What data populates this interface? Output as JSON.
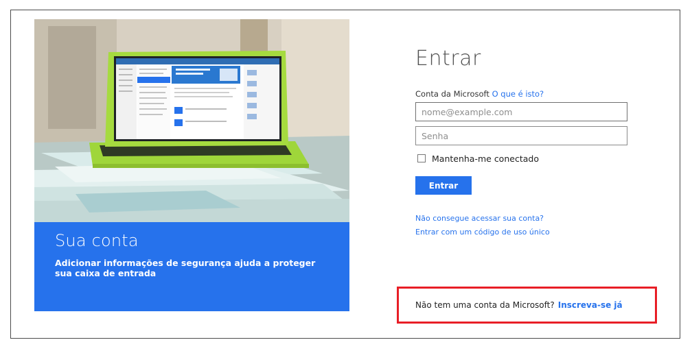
{
  "promo": {
    "title": "Sua conta",
    "text": "Adicionar informações de segurança ajuda a proteger sua caixa de entrada",
    "brand_color": "#2672ec"
  },
  "signin": {
    "title": "Entrar",
    "account_label": "Conta da Microsoft",
    "what_is_this_link": "O que é isto?",
    "email_placeholder": "nome@example.com",
    "password_placeholder": "Senha",
    "remember_label": "Mantenha-me conectado",
    "remember_checked": false,
    "submit_label": "Entrar",
    "cant_access_link": "Não consegue acessar sua conta?",
    "single_use_code_link": "Entrar com um código de uso único"
  },
  "signup": {
    "prompt": "Não tem uma conta da Microsoft?",
    "link": "Inscreva-se já",
    "highlight_color": "#e81e26"
  }
}
